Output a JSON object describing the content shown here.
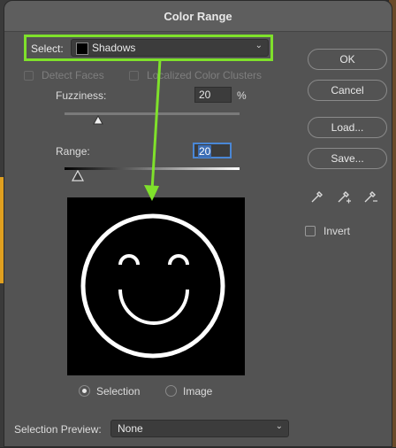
{
  "dialog": {
    "title": "Color Range"
  },
  "select": {
    "label": "Select:",
    "value": "Shadows"
  },
  "options": {
    "detect_faces": "Detect Faces",
    "localized_clusters": "Localized Color Clusters"
  },
  "fuzziness": {
    "label": "Fuzziness:",
    "value": "20",
    "unit": "%",
    "level": 0.2
  },
  "range": {
    "label": "Range:",
    "value": "20",
    "level": 0.08
  },
  "preview_mode": {
    "selection_label": "Selection",
    "image_label": "Image",
    "selected": "Selection"
  },
  "selection_preview": {
    "label": "Selection Preview:",
    "value": "None"
  },
  "buttons": {
    "ok": "OK",
    "cancel": "Cancel",
    "load": "Load...",
    "save": "Save..."
  },
  "invert": {
    "label": "Invert",
    "checked": false
  },
  "icons": [
    "eyedropper-icon",
    "eyedropper-plus-icon",
    "eyedropper-minus-icon"
  ],
  "colors": {
    "highlight": "#7fe12b",
    "focus": "#4a87d6",
    "panel": "#535353"
  }
}
